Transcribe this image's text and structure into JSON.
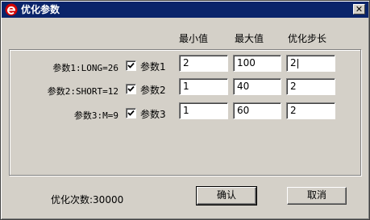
{
  "window": {
    "title": "优化参数",
    "close_label": "✕"
  },
  "columns": {
    "min": "最小值",
    "max": "最大值",
    "step": "优化步长"
  },
  "rows": [
    {
      "label": "参数1:LONG=26",
      "checkbox_label": "参数1",
      "checked": true,
      "min": "2",
      "max": "100",
      "step": "2"
    },
    {
      "label": "参数2:SHORT=12",
      "checkbox_label": "参数2",
      "checked": true,
      "min": "1",
      "max": "40",
      "step": "2"
    },
    {
      "label": "参数3:M=9",
      "checkbox_label": "参数3",
      "checked": true,
      "min": "1",
      "max": "60",
      "step": "2"
    }
  ],
  "footer": {
    "count_text": "优化次数:30000"
  },
  "buttons": {
    "confirm": "确认",
    "cancel": "取消"
  },
  "icons": {
    "app": "app-logo-icon",
    "close": "close-icon",
    "check": "checkmark-icon"
  },
  "colors": {
    "titlebar": "#0a246a",
    "logo": "#d40000"
  }
}
